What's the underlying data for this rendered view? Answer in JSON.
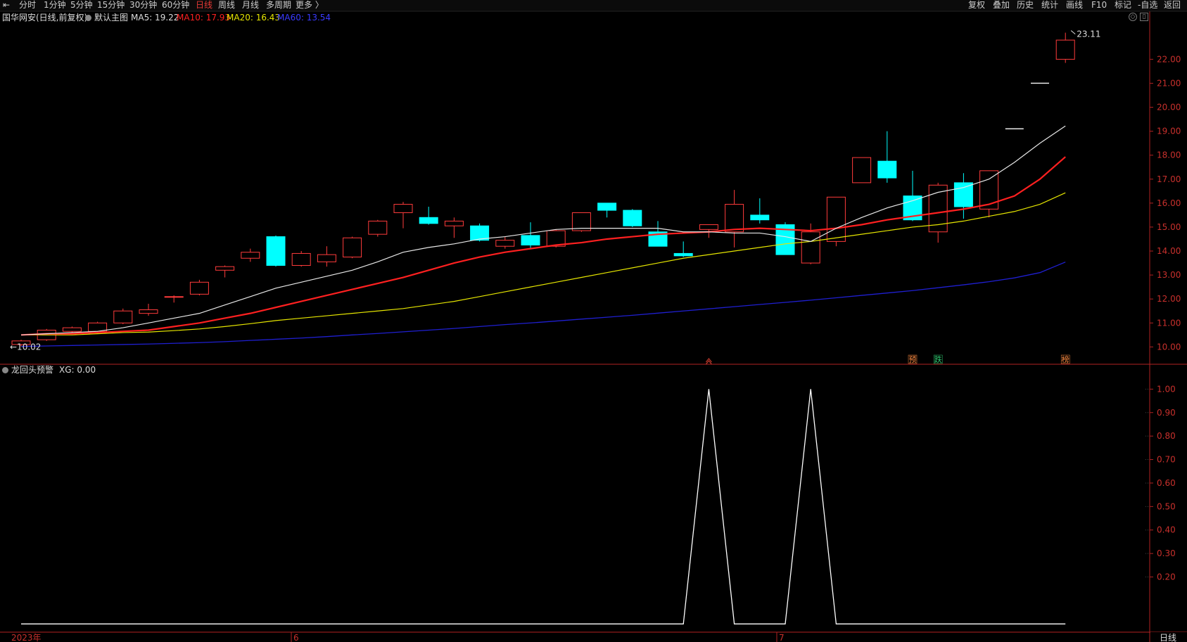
{
  "toolbar": {
    "left": [
      "分时",
      "1分钟",
      "5分钟",
      "15分钟",
      "30分钟",
      "60分钟",
      "日线",
      "周线",
      "月线",
      "多周期",
      "更多 〉"
    ],
    "active": "日线",
    "right": [
      "复权",
      "叠加",
      "历史",
      "统计",
      "画线",
      "F10",
      "标记",
      "-自选",
      "返回"
    ]
  },
  "info": {
    "stock": "国华网安(日线,前复权)",
    "template": "默认主图",
    "ma5": "MA5: 19.22",
    "ma10": "MA10: 17.93",
    "ma20": "MA20: 16.43",
    "ma60": "MA60: 13.54"
  },
  "indicator": {
    "title": "龙回头预警",
    "value": "XG: 0.00"
  },
  "markers": {
    "high": "23.11",
    "low": "10.02"
  },
  "signals": [
    {
      "label": "预",
      "bar": 35,
      "color": "#ff8c42"
    },
    {
      "label": "跌",
      "bar": 36,
      "color": "#2ecc71"
    },
    {
      "label": "榜",
      "bar": 41,
      "color": "#ff8c42"
    }
  ],
  "signal_arrow_bar": 27,
  "date_labels": {
    "year": "2023年",
    "jun": "6",
    "jul": "7"
  },
  "period_tag": "日线",
  "colors": {
    "up": "#ff3b3b",
    "down": "#00ffff",
    "ma5": "#e8e8e8",
    "ma10": "#ff2020",
    "ma20": "#e6e600",
    "ma60": "#1f1fd0",
    "axis": "#b22222",
    "indicator": "#ffffff"
  },
  "chart_data": [
    {
      "type": "candlestick",
      "price_axis": [
        10,
        11,
        12,
        13,
        14,
        15,
        16,
        17,
        18,
        19,
        20,
        21,
        22
      ],
      "ylim": [
        9.6,
        23.3
      ],
      "candles": [
        {
          "o": 10.1,
          "h": 10.3,
          "l": 10.02,
          "c": 10.25
        },
        {
          "o": 10.3,
          "h": 10.75,
          "l": 10.25,
          "c": 10.7
        },
        {
          "o": 10.65,
          "h": 10.85,
          "l": 10.55,
          "c": 10.8
        },
        {
          "o": 10.65,
          "h": 11.05,
          "l": 10.6,
          "c": 11.0
        },
        {
          "o": 11.0,
          "h": 11.6,
          "l": 10.95,
          "c": 11.5
        },
        {
          "o": 11.4,
          "h": 11.8,
          "l": 11.3,
          "c": 11.55
        },
        {
          "o": 12.1,
          "h": 12.15,
          "l": 11.85,
          "c": 12.1
        },
        {
          "o": 12.2,
          "h": 12.8,
          "l": 12.15,
          "c": 12.7
        },
        {
          "o": 13.2,
          "h": 13.4,
          "l": 12.9,
          "c": 13.35
        },
        {
          "o": 13.7,
          "h": 14.1,
          "l": 13.55,
          "c": 13.95
        },
        {
          "o": 14.6,
          "h": 14.65,
          "l": 13.35,
          "c": 13.4
        },
        {
          "o": 13.4,
          "h": 14.0,
          "l": 13.35,
          "c": 13.9
        },
        {
          "o": 13.55,
          "h": 14.2,
          "l": 13.35,
          "c": 13.85
        },
        {
          "o": 13.75,
          "h": 14.6,
          "l": 13.7,
          "c": 14.55
        },
        {
          "o": 14.7,
          "h": 15.3,
          "l": 14.6,
          "c": 15.25
        },
        {
          "o": 15.6,
          "h": 16.05,
          "l": 14.95,
          "c": 15.95
        },
        {
          "o": 15.4,
          "h": 15.85,
          "l": 15.1,
          "c": 15.15
        },
        {
          "o": 15.05,
          "h": 15.4,
          "l": 14.55,
          "c": 15.25
        },
        {
          "o": 15.05,
          "h": 15.15,
          "l": 14.4,
          "c": 14.45
        },
        {
          "o": 14.2,
          "h": 14.6,
          "l": 14.1,
          "c": 14.45
        },
        {
          "o": 14.65,
          "h": 15.2,
          "l": 14.1,
          "c": 14.25
        },
        {
          "o": 14.2,
          "h": 14.9,
          "l": 14.15,
          "c": 14.85
        },
        {
          "o": 14.85,
          "h": 15.6,
          "l": 14.8,
          "c": 15.6
        },
        {
          "o": 16.0,
          "h": 16.0,
          "l": 15.4,
          "c": 15.7
        },
        {
          "o": 15.7,
          "h": 15.75,
          "l": 15.0,
          "c": 15.05
        },
        {
          "o": 14.8,
          "h": 15.25,
          "l": 14.2,
          "c": 14.2
        },
        {
          "o": 13.9,
          "h": 14.4,
          "l": 13.75,
          "c": 13.8
        },
        {
          "o": 14.9,
          "h": 15.1,
          "l": 14.55,
          "c": 15.1
        },
        {
          "o": 14.8,
          "h": 16.55,
          "l": 14.15,
          "c": 15.95
        },
        {
          "o": 15.5,
          "h": 16.2,
          "l": 15.15,
          "c": 15.3
        },
        {
          "o": 15.1,
          "h": 15.2,
          "l": 13.85,
          "c": 13.85
        },
        {
          "o": 13.5,
          "h": 15.15,
          "l": 13.45,
          "c": 14.8
        },
        {
          "o": 14.4,
          "h": 16.25,
          "l": 14.2,
          "c": 16.25
        },
        {
          "o": 16.85,
          "h": 17.9,
          "l": 16.85,
          "c": 17.9
        },
        {
          "o": 17.75,
          "h": 19.0,
          "l": 16.85,
          "c": 17.05
        },
        {
          "o": 16.3,
          "h": 17.35,
          "l": 15.25,
          "c": 15.3
        },
        {
          "o": 14.8,
          "h": 16.85,
          "l": 14.35,
          "c": 16.75
        },
        {
          "o": 16.85,
          "h": 17.25,
          "l": 15.35,
          "c": 15.85
        },
        {
          "o": 15.75,
          "h": 17.35,
          "l": 15.4,
          "c": 17.35
        },
        {
          "o": 19.1,
          "h": 19.1,
          "l": 19.1,
          "c": 19.1
        },
        {
          "o": 21.0,
          "h": 21.0,
          "l": 21.0,
          "c": 21.0
        },
        {
          "o": 22.0,
          "h": 23.11,
          "l": 21.85,
          "c": 22.8
        }
      ],
      "ma5": [
        10.5,
        10.55,
        10.6,
        10.65,
        10.8,
        11.0,
        11.2,
        11.4,
        11.75,
        12.1,
        12.45,
        12.7,
        12.95,
        13.2,
        13.55,
        13.95,
        14.15,
        14.3,
        14.5,
        14.6,
        14.75,
        14.9,
        14.95,
        14.95,
        14.95,
        14.95,
        14.8,
        14.8,
        14.75,
        14.75,
        14.6,
        14.4,
        14.95,
        15.4,
        15.8,
        16.1,
        16.45,
        16.65,
        17.0,
        17.7,
        18.5,
        19.22
      ],
      "ma10": [
        10.5,
        10.55,
        10.55,
        10.6,
        10.65,
        10.7,
        10.85,
        11.0,
        11.2,
        11.4,
        11.65,
        11.9,
        12.15,
        12.4,
        12.65,
        12.9,
        13.2,
        13.5,
        13.75,
        13.95,
        14.1,
        14.25,
        14.35,
        14.5,
        14.6,
        14.7,
        14.75,
        14.8,
        14.9,
        14.95,
        14.9,
        14.85,
        14.95,
        15.1,
        15.3,
        15.45,
        15.6,
        15.75,
        15.95,
        16.3,
        17.0,
        17.93
      ],
      "ma20": [
        10.5,
        10.5,
        10.5,
        10.55,
        10.6,
        10.62,
        10.68,
        10.75,
        10.85,
        10.97,
        11.1,
        11.2,
        11.3,
        11.4,
        11.5,
        11.6,
        11.75,
        11.9,
        12.1,
        12.3,
        12.5,
        12.7,
        12.9,
        13.1,
        13.3,
        13.5,
        13.7,
        13.85,
        14.0,
        14.15,
        14.3,
        14.4,
        14.55,
        14.7,
        14.85,
        15.0,
        15.1,
        15.25,
        15.45,
        15.65,
        15.95,
        16.43
      ],
      "ma60": [
        10.02,
        10.04,
        10.06,
        10.08,
        10.1,
        10.12,
        10.15,
        10.18,
        10.22,
        10.27,
        10.32,
        10.37,
        10.43,
        10.5,
        10.56,
        10.63,
        10.7,
        10.77,
        10.85,
        10.93,
        11.0,
        11.08,
        11.16,
        11.24,
        11.32,
        11.41,
        11.5,
        11.59,
        11.68,
        11.77,
        11.86,
        11.95,
        12.05,
        12.15,
        12.25,
        12.35,
        12.47,
        12.59,
        12.72,
        12.88,
        13.1,
        13.54
      ]
    },
    {
      "type": "line",
      "title": "龙回头预警",
      "y_axis": [
        0.2,
        0.3,
        0.4,
        0.5,
        0.6,
        0.7,
        0.8,
        0.9,
        1.0
      ],
      "ylim": [
        -0.02,
        1.04
      ],
      "series": [
        {
          "values": [
            0,
            0,
            0,
            0,
            0,
            0,
            0,
            0,
            0,
            0,
            0,
            0,
            0,
            0,
            0,
            0,
            0,
            0,
            0,
            0,
            0,
            0,
            0,
            0,
            0,
            0,
            0,
            1,
            0,
            0,
            0,
            1,
            0,
            0,
            0,
            0,
            0,
            0,
            0,
            0,
            0,
            0
          ]
        }
      ]
    }
  ]
}
